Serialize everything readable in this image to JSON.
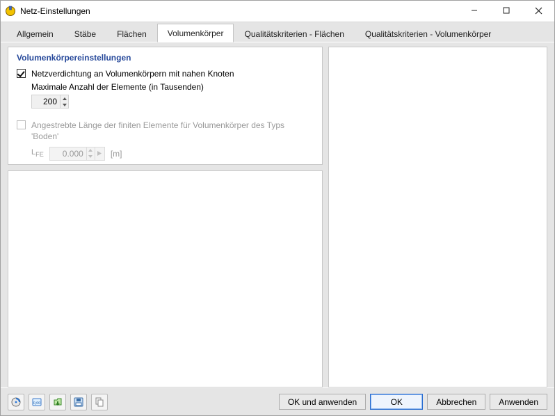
{
  "window": {
    "title": "Netz-Einstellungen"
  },
  "tabs": [
    {
      "label": "Allgemein",
      "active": false
    },
    {
      "label": "Stäbe",
      "active": false
    },
    {
      "label": "Flächen",
      "active": false
    },
    {
      "label": "Volumenkörper",
      "active": true
    },
    {
      "label": "Qualitätskriterien - Flächen",
      "active": false
    },
    {
      "label": "Qualitätskriterien - Volumenkörper",
      "active": false
    }
  ],
  "settings": {
    "group_title": "Volumenkörpereinstellungen",
    "refine_close_nodes": {
      "checked": true,
      "label": "Netzverdichtung an Volumenkörpern mit nahen Knoten",
      "sublabel": "Maximale Anzahl der Elemente (in Tausenden)",
      "value": "200"
    },
    "target_fe_length": {
      "enabled": false,
      "label": "Angestrebte Länge der finiten Elemente für Volumenkörper des Typs 'Boden'",
      "symbol": "LFE",
      "value": "0.000",
      "unit": "[m]"
    }
  },
  "footer": {
    "ok_apply": "OK und anwenden",
    "ok": "OK",
    "cancel": "Abbrechen",
    "apply": "Anwenden"
  },
  "colors": {
    "heading": "#284a9b"
  }
}
